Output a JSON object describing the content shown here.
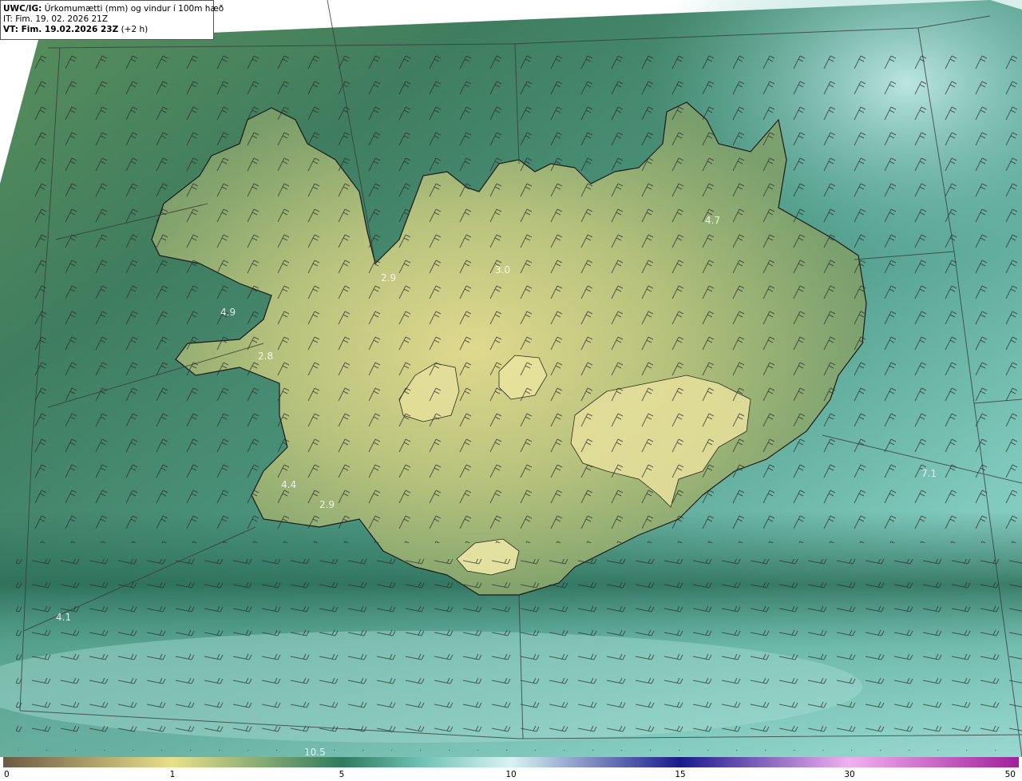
{
  "info": {
    "title_bold": "UWC/IG:",
    "title_rest": " Úrkomumætti (mm) og vindur í 100m hæð",
    "it_line": "IT: Fim. 19. 02. 2026 21Z",
    "vt_bold": "VT: Fim. 19.02.2026 23Z",
    "vt_rest": " (+2 h)"
  },
  "colorbar": {
    "ticks": [
      {
        "label": "0",
        "value": 0
      },
      {
        "label": "1",
        "value": 1
      },
      {
        "label": "5",
        "value": 5
      },
      {
        "label": "10",
        "value": 10
      },
      {
        "label": "15",
        "value": 15
      },
      {
        "label": "30",
        "value": 30
      },
      {
        "label": "50",
        "value": 50
      }
    ],
    "colors": {
      "c0": "#6b5a44",
      "c1": "#e8e08a",
      "c5": "#2f7a5e",
      "c7": "#6ec0b2",
      "c10": "#d8f3f3",
      "c15": "#1a1a8c",
      "c30": "#f2b0f0",
      "c50": "#a0209a"
    }
  },
  "map_values": [
    {
      "label": "4.7"
    },
    {
      "label": "2.9"
    },
    {
      "label": "3.0"
    },
    {
      "label": "4.9"
    },
    {
      "label": "2.8"
    },
    {
      "label": "4.4"
    },
    {
      "label": "2.9"
    },
    {
      "label": "7.1"
    },
    {
      "label": "4.1"
    },
    {
      "label": "10.5"
    }
  ],
  "colors": {
    "land_low": "#d6d38a",
    "land_mid": "#9fb774",
    "sea_dark": "#2e6f5a",
    "sea_light": "#7ecdc0",
    "coast": "#1a1a1a",
    "grid": "#3a3a3a"
  }
}
